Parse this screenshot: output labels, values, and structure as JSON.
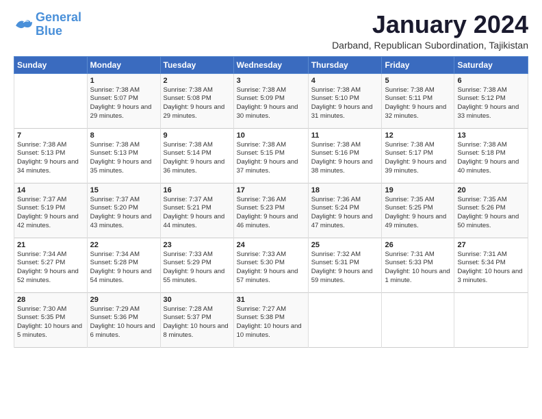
{
  "logo": {
    "text_general": "General",
    "text_blue": "Blue"
  },
  "header": {
    "month_title": "January 2024",
    "subtitle": "Darband, Republican Subordination, Tajikistan"
  },
  "weekdays": [
    "Sunday",
    "Monday",
    "Tuesday",
    "Wednesday",
    "Thursday",
    "Friday",
    "Saturday"
  ],
  "weeks": [
    [
      {
        "day": "",
        "sunrise": "",
        "sunset": "",
        "daylight": ""
      },
      {
        "day": "1",
        "sunrise": "Sunrise: 7:38 AM",
        "sunset": "Sunset: 5:07 PM",
        "daylight": "Daylight: 9 hours and 29 minutes."
      },
      {
        "day": "2",
        "sunrise": "Sunrise: 7:38 AM",
        "sunset": "Sunset: 5:08 PM",
        "daylight": "Daylight: 9 hours and 29 minutes."
      },
      {
        "day": "3",
        "sunrise": "Sunrise: 7:38 AM",
        "sunset": "Sunset: 5:09 PM",
        "daylight": "Daylight: 9 hours and 30 minutes."
      },
      {
        "day": "4",
        "sunrise": "Sunrise: 7:38 AM",
        "sunset": "Sunset: 5:10 PM",
        "daylight": "Daylight: 9 hours and 31 minutes."
      },
      {
        "day": "5",
        "sunrise": "Sunrise: 7:38 AM",
        "sunset": "Sunset: 5:11 PM",
        "daylight": "Daylight: 9 hours and 32 minutes."
      },
      {
        "day": "6",
        "sunrise": "Sunrise: 7:38 AM",
        "sunset": "Sunset: 5:12 PM",
        "daylight": "Daylight: 9 hours and 33 minutes."
      }
    ],
    [
      {
        "day": "7",
        "sunrise": "Sunrise: 7:38 AM",
        "sunset": "Sunset: 5:13 PM",
        "daylight": "Daylight: 9 hours and 34 minutes."
      },
      {
        "day": "8",
        "sunrise": "Sunrise: 7:38 AM",
        "sunset": "Sunset: 5:13 PM",
        "daylight": "Daylight: 9 hours and 35 minutes."
      },
      {
        "day": "9",
        "sunrise": "Sunrise: 7:38 AM",
        "sunset": "Sunset: 5:14 PM",
        "daylight": "Daylight: 9 hours and 36 minutes."
      },
      {
        "day": "10",
        "sunrise": "Sunrise: 7:38 AM",
        "sunset": "Sunset: 5:15 PM",
        "daylight": "Daylight: 9 hours and 37 minutes."
      },
      {
        "day": "11",
        "sunrise": "Sunrise: 7:38 AM",
        "sunset": "Sunset: 5:16 PM",
        "daylight": "Daylight: 9 hours and 38 minutes."
      },
      {
        "day": "12",
        "sunrise": "Sunrise: 7:38 AM",
        "sunset": "Sunset: 5:17 PM",
        "daylight": "Daylight: 9 hours and 39 minutes."
      },
      {
        "day": "13",
        "sunrise": "Sunrise: 7:38 AM",
        "sunset": "Sunset: 5:18 PM",
        "daylight": "Daylight: 9 hours and 40 minutes."
      }
    ],
    [
      {
        "day": "14",
        "sunrise": "Sunrise: 7:37 AM",
        "sunset": "Sunset: 5:19 PM",
        "daylight": "Daylight: 9 hours and 42 minutes."
      },
      {
        "day": "15",
        "sunrise": "Sunrise: 7:37 AM",
        "sunset": "Sunset: 5:20 PM",
        "daylight": "Daylight: 9 hours and 43 minutes."
      },
      {
        "day": "16",
        "sunrise": "Sunrise: 7:37 AM",
        "sunset": "Sunset: 5:21 PM",
        "daylight": "Daylight: 9 hours and 44 minutes."
      },
      {
        "day": "17",
        "sunrise": "Sunrise: 7:36 AM",
        "sunset": "Sunset: 5:23 PM",
        "daylight": "Daylight: 9 hours and 46 minutes."
      },
      {
        "day": "18",
        "sunrise": "Sunrise: 7:36 AM",
        "sunset": "Sunset: 5:24 PM",
        "daylight": "Daylight: 9 hours and 47 minutes."
      },
      {
        "day": "19",
        "sunrise": "Sunrise: 7:35 AM",
        "sunset": "Sunset: 5:25 PM",
        "daylight": "Daylight: 9 hours and 49 minutes."
      },
      {
        "day": "20",
        "sunrise": "Sunrise: 7:35 AM",
        "sunset": "Sunset: 5:26 PM",
        "daylight": "Daylight: 9 hours and 50 minutes."
      }
    ],
    [
      {
        "day": "21",
        "sunrise": "Sunrise: 7:34 AM",
        "sunset": "Sunset: 5:27 PM",
        "daylight": "Daylight: 9 hours and 52 minutes."
      },
      {
        "day": "22",
        "sunrise": "Sunrise: 7:34 AM",
        "sunset": "Sunset: 5:28 PM",
        "daylight": "Daylight: 9 hours and 54 minutes."
      },
      {
        "day": "23",
        "sunrise": "Sunrise: 7:33 AM",
        "sunset": "Sunset: 5:29 PM",
        "daylight": "Daylight: 9 hours and 55 minutes."
      },
      {
        "day": "24",
        "sunrise": "Sunrise: 7:33 AM",
        "sunset": "Sunset: 5:30 PM",
        "daylight": "Daylight: 9 hours and 57 minutes."
      },
      {
        "day": "25",
        "sunrise": "Sunrise: 7:32 AM",
        "sunset": "Sunset: 5:31 PM",
        "daylight": "Daylight: 9 hours and 59 minutes."
      },
      {
        "day": "26",
        "sunrise": "Sunrise: 7:31 AM",
        "sunset": "Sunset: 5:33 PM",
        "daylight": "Daylight: 10 hours and 1 minute."
      },
      {
        "day": "27",
        "sunrise": "Sunrise: 7:31 AM",
        "sunset": "Sunset: 5:34 PM",
        "daylight": "Daylight: 10 hours and 3 minutes."
      }
    ],
    [
      {
        "day": "28",
        "sunrise": "Sunrise: 7:30 AM",
        "sunset": "Sunset: 5:35 PM",
        "daylight": "Daylight: 10 hours and 5 minutes."
      },
      {
        "day": "29",
        "sunrise": "Sunrise: 7:29 AM",
        "sunset": "Sunset: 5:36 PM",
        "daylight": "Daylight: 10 hours and 6 minutes."
      },
      {
        "day": "30",
        "sunrise": "Sunrise: 7:28 AM",
        "sunset": "Sunset: 5:37 PM",
        "daylight": "Daylight: 10 hours and 8 minutes."
      },
      {
        "day": "31",
        "sunrise": "Sunrise: 7:27 AM",
        "sunset": "Sunset: 5:38 PM",
        "daylight": "Daylight: 10 hours and 10 minutes."
      },
      {
        "day": "",
        "sunrise": "",
        "sunset": "",
        "daylight": ""
      },
      {
        "day": "",
        "sunrise": "",
        "sunset": "",
        "daylight": ""
      },
      {
        "day": "",
        "sunrise": "",
        "sunset": "",
        "daylight": ""
      }
    ]
  ]
}
